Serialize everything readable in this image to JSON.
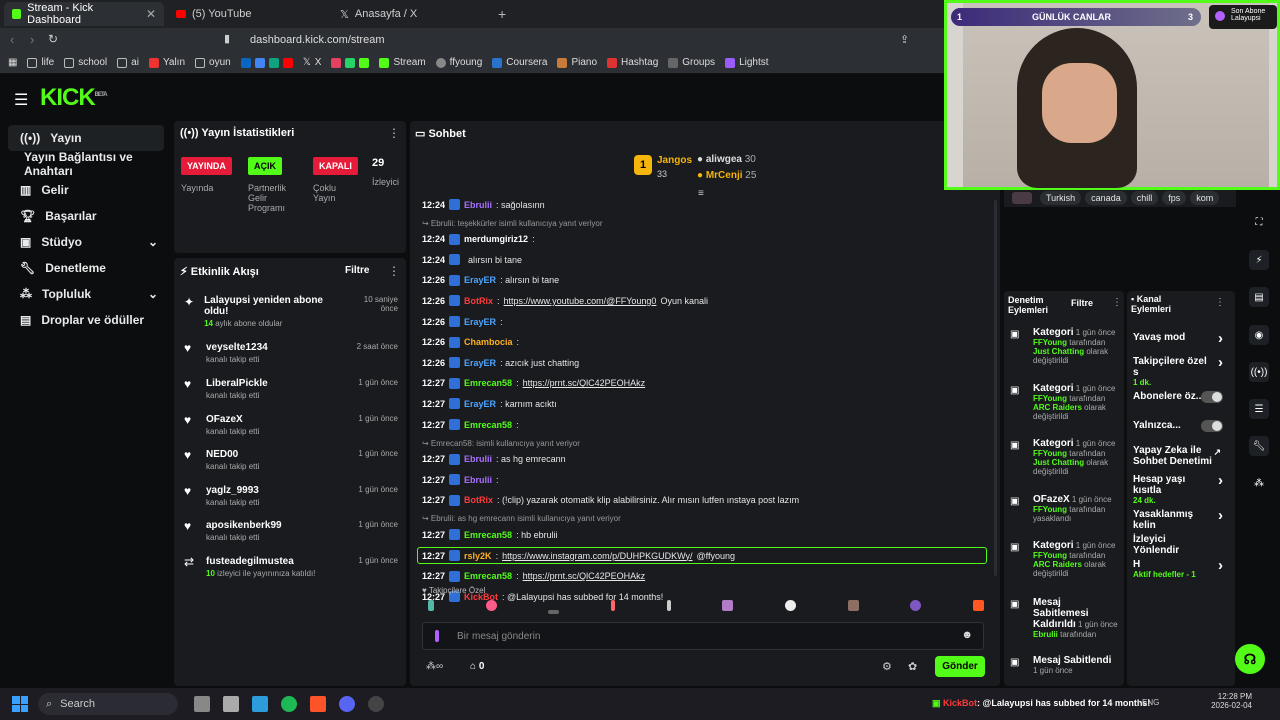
{
  "browser": {
    "tabs": [
      {
        "label": "Stream - Kick Dashboard",
        "active": true
      },
      {
        "label": "(5) YouTube",
        "active": false
      },
      {
        "label": "Anasayfa / X",
        "active": false
      }
    ],
    "url": "dashboard.kick.com/stream",
    "bookmarks": [
      "life",
      "school",
      "ai",
      "Yalın",
      "oyun",
      "X",
      "Stream",
      "ffyoung",
      "Coursera",
      "Piano",
      "Hashtag",
      "Groups",
      "Lightst"
    ]
  },
  "kick": {
    "logo": "KICK",
    "logo_beta": "BETA",
    "nav": [
      {
        "label": "Yayın",
        "icon": "broadcast-icon",
        "active": true
      },
      {
        "label": "Yayın Bağlantısı ve Anahtarı",
        "icon": "",
        "active": false
      },
      {
        "label": "Gelir",
        "icon": "chart-icon",
        "active": false
      },
      {
        "label": "Başarılar",
        "icon": "trophy-icon",
        "active": false
      },
      {
        "label": "Stüdyo",
        "icon": "studio-icon",
        "active": false,
        "expand": true
      },
      {
        "label": "Denetleme",
        "icon": "wrench-icon",
        "active": false
      },
      {
        "label": "Topluluk",
        "icon": "community-icon",
        "active": false,
        "expand": true
      },
      {
        "label": "Droplar ve ödüller",
        "icon": "drops-icon",
        "active": false
      }
    ]
  },
  "stats": {
    "title": "Yayın İstatistikleri",
    "items": [
      {
        "pill": "YAYINDA",
        "pill_color": "#e51b3a",
        "label": "Yayında"
      },
      {
        "pill": "AÇIK",
        "pill_color": "#53fc18",
        "label": "Partnerlik Gelir Programı"
      },
      {
        "pill": "KAPALI",
        "pill_color": "#e51b3a",
        "label": "Çoklu Yayın"
      },
      {
        "pill": "29",
        "pill_color": "",
        "label": "İzleyici"
      }
    ]
  },
  "activity": {
    "title": "Etkinlik Akışı",
    "filter": "Filtre",
    "items": [
      {
        "name": "Lalayupsi yeniden abone oldu!",
        "sub_green": "14",
        "sub": "aylık abone oldular",
        "time": "10 saniye önce",
        "icon": "sparkle-icon"
      },
      {
        "name": "veyselte1234",
        "sub": "kanalı takip etti",
        "time": "2 saat önce",
        "icon": "heart-icon"
      },
      {
        "name": "LiberalPickle",
        "sub": "kanalı takip etti",
        "time": "1 gün önce",
        "icon": "heart-icon"
      },
      {
        "name": "OFazeX",
        "sub": "kanalı takip etti",
        "time": "1 gün önce",
        "icon": "heart-icon"
      },
      {
        "name": "NED00",
        "sub": "kanalı takip etti",
        "time": "1 gün önce",
        "icon": "heart-icon"
      },
      {
        "name": "yaglz_9993",
        "sub": "kanalı takip etti",
        "time": "1 gün önce",
        "icon": "heart-icon"
      },
      {
        "name": "aposikenberk99",
        "sub": "kanalı takip etti",
        "time": "1 gün önce",
        "icon": "heart-icon"
      },
      {
        "name": "fusteadegilmustea",
        "sub_green": "10",
        "sub": "izleyici ile yayınınıza katıldı!",
        "time": "1 gün önce",
        "icon": "raid-icon"
      }
    ]
  },
  "chat": {
    "title": "Sohbet",
    "leaderboard": [
      {
        "name": "Jangos",
        "value": "33",
        "rank": "1"
      },
      {
        "name": "aliwgea",
        "value": "30"
      },
      {
        "name": "MrCenji",
        "value": "25"
      }
    ],
    "messages": [
      {
        "time": "12:24",
        "user": "Ebrulii",
        "color": "#a970ff",
        "text": ": sağolasınn"
      },
      {
        "reply": "Ebrulii: teşekkürler isimli kullanıcıya yanıt veriyor"
      },
      {
        "time": "12:24",
        "user": "merdumgiriz12",
        "color": "#ffffff",
        "text": ":"
      },
      {
        "time": "12:24",
        "user": "",
        "color": "#ffffff",
        "text": "alırsın bi tane"
      },
      {
        "time": "12:26",
        "user": "ErayER",
        "color": "#4da6ff",
        "text": ": alırsın bi tane"
      },
      {
        "time": "12:26",
        "user": "BotRix",
        "color": "#ff3b3b",
        "text": ": ",
        "link": "https://www.youtube.com/@FFYoung0",
        "after": " Oyun kanali"
      },
      {
        "time": "12:26",
        "user": "ErayER",
        "color": "#4da6ff",
        "text": ":"
      },
      {
        "time": "12:26",
        "user": "Chambocia",
        "color": "#ffb020",
        "text": ":"
      },
      {
        "time": "12:26",
        "user": "ErayER",
        "color": "#4da6ff",
        "text": ": azıcık just chatting"
      },
      {
        "time": "12:27",
        "user": "Emrecan58",
        "color": "#53fc18",
        "text": ": ",
        "link": "https://prnt.sc/QlC42PEOHAkz"
      },
      {
        "time": "12:27",
        "user": "ErayER",
        "color": "#4da6ff",
        "text": ": karnım acıktı"
      },
      {
        "time": "12:27",
        "user": "Emrecan58",
        "color": "#53fc18",
        "text": ":"
      },
      {
        "reply": "Emrecan58: isimli kullanıcıya yanıt veriyor"
      },
      {
        "time": "12:27",
        "user": "Ebrulii",
        "color": "#a970ff",
        "text": ": as hg emrecann"
      },
      {
        "time": "12:27",
        "user": "Ebrulii",
        "color": "#a970ff",
        "text": ":"
      },
      {
        "time": "12:27",
        "user": "BotRix",
        "color": "#ff3b3b",
        "text": ": (!clip) yazarak otomatik klip alabilirsiniz. Alır mısın lutfen ınstaya post lazım"
      },
      {
        "reply": "Ebrulii: as hg emrecann isimli kullanıcıya yanıt veriyor"
      },
      {
        "time": "12:27",
        "user": "Emrecan58",
        "color": "#53fc18",
        "text": ": hb ebrulii"
      },
      {
        "time": "12:27",
        "user": "rsly2K",
        "color": "#ffb020",
        "text": ": ",
        "link": "https://www.instagram.com/p/DUHPKGUDKWy/",
        "after": " @ffyoung",
        "highlight": true
      },
      {
        "time": "12:27",
        "user": "Emrecan58",
        "color": "#53fc18",
        "text": ": ",
        "link": "https://prnt.sc/QlC42PEOHAkz"
      },
      {
        "time": "12:27",
        "user": "KickBot",
        "color": "#ff3b3b",
        "text": ": @Lalayupsi has subbed for 14 months!"
      }
    ],
    "followers_only": "Takipçilere Özel",
    "input_placeholder": "Bir mesaj gönderin",
    "points": "0",
    "send": "Gönder"
  },
  "video": {
    "overlay_rank": "1",
    "overlay_title": "GÜNLÜK CANLAR",
    "overlay_count": "3",
    "last_sub_label": "Son Abone",
    "last_sub_name": "Lalayupsi",
    "tags": [
      "Turkish",
      "canada",
      "chill",
      "fps",
      "kom"
    ]
  },
  "mod_actions": {
    "title": "Denetim Eylemleri",
    "filter": "Filtre",
    "items": [
      {
        "title": "Kategori",
        "time": "1 gün önce",
        "by": "FFYoung",
        "mid": "tarafından",
        "green2": "Just Chatting",
        "tail": "olarak değiştirildi"
      },
      {
        "title": "Kategori",
        "time": "1 gün önce",
        "by": "FFYoung",
        "mid": "tarafından",
        "green2": "ARC Raiders",
        "tail": "olarak değiştirildi"
      },
      {
        "title": "Kategori",
        "time": "1 gün önce",
        "by": "FFYoung",
        "mid": "tarafından",
        "green2": "Just Chatting",
        "tail": "olarak değiştirildi"
      },
      {
        "title": "OFazeX",
        "time": "1 gün önce",
        "by": "FFYoung",
        "mid": "tarafından yasaklandı",
        "green2": "",
        "tail": ""
      },
      {
        "title": "Kategori",
        "time": "1 gün önce",
        "by": "FFYoung",
        "mid": "tarafından",
        "green2": "ARC Raiders",
        "tail": "olarak değiştirildi"
      },
      {
        "title": "Mesaj Sabitlemesi Kaldırıldı",
        "time": "1 gün önce",
        "by": "Ebrulii",
        "mid": "tarafından",
        "green2": "",
        "tail": ""
      },
      {
        "title": "Mesaj Sabitlendi",
        "time": "1 gün önce",
        "by": "",
        "mid": "",
        "green2": "",
        "tail": ""
      }
    ]
  },
  "channel_actions": {
    "title": "Kanal Eylemleri",
    "items": [
      {
        "label": "Yavaş mod",
        "control": "arrow"
      },
      {
        "label": "Takipçilere özel s",
        "sub": "1 dk.",
        "control": "arrow"
      },
      {
        "label": "Abonelere öz...",
        "control": "toggle"
      },
      {
        "label": "Yalnızca...",
        "control": "toggle"
      },
      {
        "label": "Yapay Zeka ile Sohbet Denetimi",
        "control": "external"
      },
      {
        "label": "Hesap yaşı kısıtla",
        "sub": "24 dk.",
        "control": "arrow"
      },
      {
        "label": "Yasaklanmış kelin",
        "control": "arrow"
      },
      {
        "label": "İzleyici Yönlendir",
        "control": ""
      },
      {
        "label": "H",
        "sub": "Aktif hedefler - 1",
        "control": "arrow"
      }
    ]
  },
  "taskbar": {
    "search": "Search",
    "ticker_user": "KickBot",
    "ticker_text": ": @Lalayupsi has subbed for 14 months!",
    "lang": "ENG",
    "time": "12:28 PM",
    "date": "2026-02-04"
  }
}
